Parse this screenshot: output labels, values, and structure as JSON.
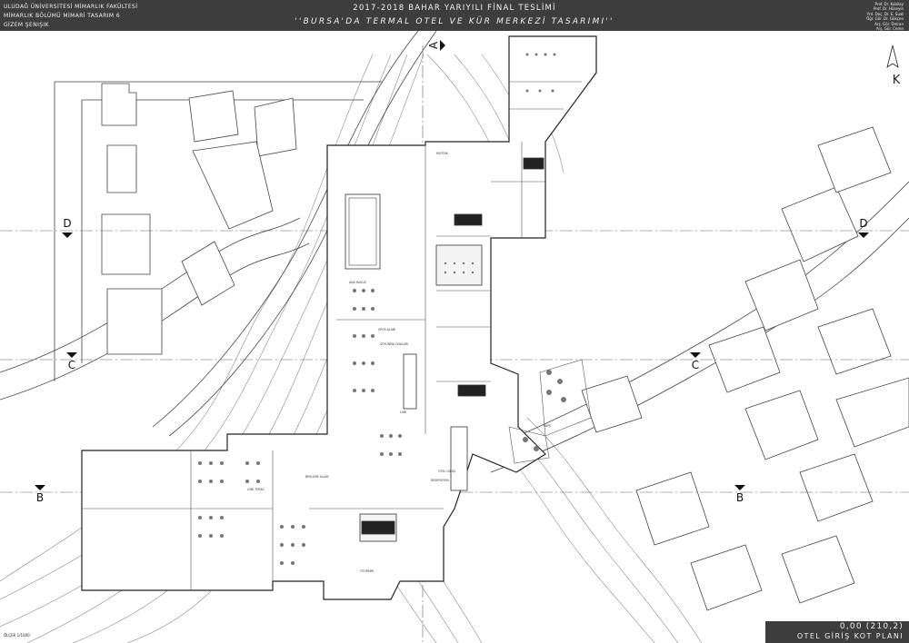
{
  "header": {
    "left_lines": [
      "ULUDAĞ ÜNİVERSİTESİ MİMARLIK FAKÜLTESİ",
      "MİMARLIK BÖLÜMÜ MİMARİ TASARIM 6",
      "GİZEM ŞENIŞIK"
    ],
    "title_line1": "2017-2018 BAHAR YARIYILI FİNAL TESLİMİ",
    "title_line2": "''BURSA'DA TERMAL OTEL VE  KÜR MERKEZİ TASARIMI''",
    "right_lines": [
      "Prof. Dr. Kubilay",
      "Prof. Dr. Hüseyin",
      "Yrd. Doç. Dr. E. Suat",
      "Öğr. Gör. Dr. Gökçen",
      "Arş. Gör. Ümran",
      "Arş. Gör. Ceren"
    ]
  },
  "plan": {
    "section_labels": [
      "A",
      "B",
      "B",
      "C",
      "C",
      "D",
      "D"
    ],
    "north_label": "K",
    "room_labels": [
      "ANA HAVUZ",
      "LOBİ",
      "LOBİ TERAS",
      "OTEL GİRİŞİ",
      "RESEPSİYON",
      "BEKLEME ALANI",
      "SPOR ALANI",
      "KAFE",
      "SOYUNMA ODALARI",
      "MUTFAK",
      "OTOPARK"
    ],
    "colors": {
      "line": "#333333",
      "light": "#9a9a9a",
      "header": "#3d3d3d"
    }
  },
  "footer": {
    "elevation": "0,00 (210,2)",
    "plan_title": "OTEL GİRİŞ KOT PLANI",
    "scale_text": "ÖLÇEK 1/1000"
  }
}
